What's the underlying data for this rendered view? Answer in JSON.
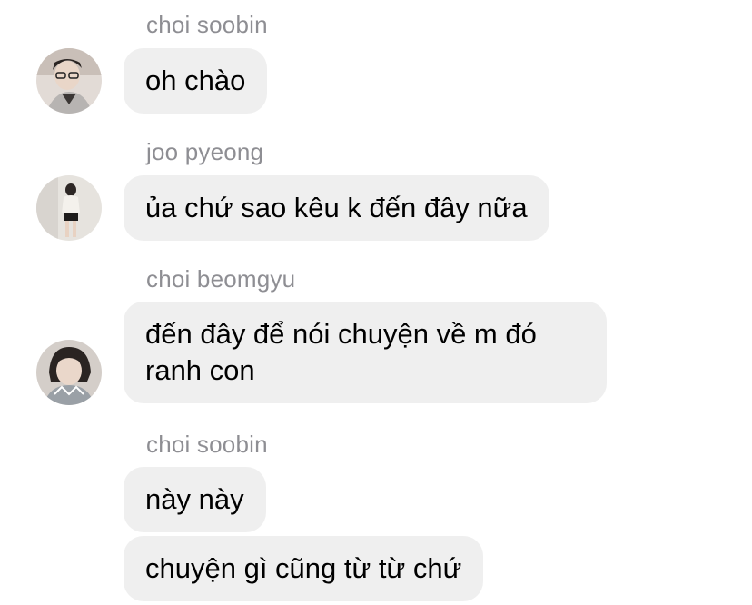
{
  "messages": [
    {
      "sender": "choi soobin",
      "text": "oh chào"
    },
    {
      "sender": "joo pyeong",
      "text": "ủa chứ sao kêu k đến đây nữa"
    },
    {
      "sender": "choi beomgyu",
      "text": "đến đây để nói chuyện về m đó ranh con"
    },
    {
      "sender": "choi soobin",
      "texts": [
        "này này",
        "chuyện gì cũng từ từ chứ"
      ]
    }
  ],
  "avatars": [
    {
      "icon": "avatar-choi-soobin",
      "bg": "#d9d2cd"
    },
    {
      "icon": "avatar-joo-pyeong",
      "bg": "#e4e1dc"
    },
    {
      "icon": "avatar-choi-beomgyu",
      "bg": "#cfc9c4"
    }
  ],
  "colors": {
    "bubble": "#efefef",
    "sender_name": "#8e8e93",
    "text": "#000000",
    "background": "#ffffff"
  }
}
